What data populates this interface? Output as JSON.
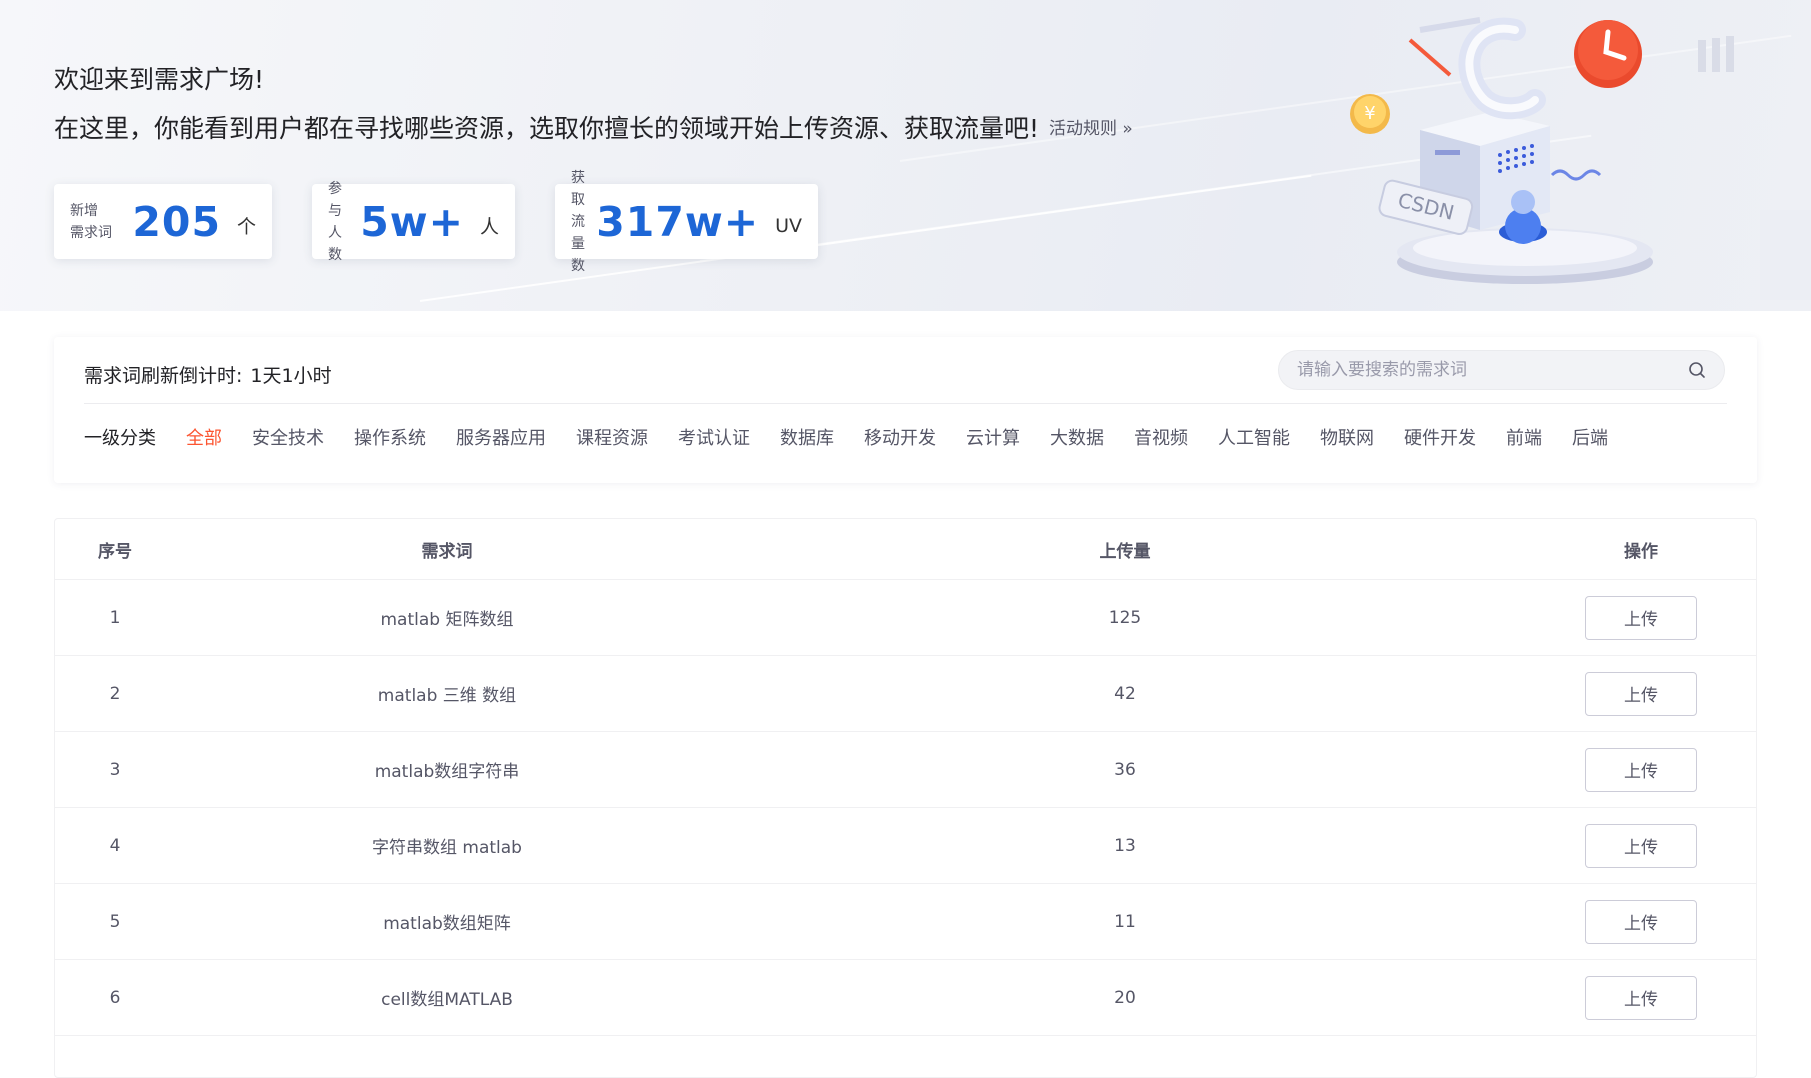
{
  "banner": {
    "welcome": "欢迎来到需求广场!",
    "subtitle": "在这里，你能看到用户都在寻找哪些资源，选取你擅长的领域开始上传资源、获取流量吧!",
    "rules_link": "活动规则 »",
    "stats": [
      {
        "label_line1": "新增",
        "label_line2": "需求词",
        "value": "205",
        "unit": "个"
      },
      {
        "label_line1": "参与",
        "label_line2": "人数",
        "value": "5w+",
        "unit": "人"
      },
      {
        "label_line1": "获取",
        "label_line2": "流量数",
        "value": "317w+",
        "unit": "UV"
      }
    ],
    "illustration_text": "CSDN"
  },
  "filter": {
    "countdown_label": "需求词刷新倒计时:",
    "countdown_value": "1天1小时",
    "search_placeholder": "请输入要搜索的需求词",
    "category_heading": "一级分类",
    "categories": [
      "全部",
      "安全技术",
      "操作系统",
      "服务器应用",
      "课程资源",
      "考试认证",
      "数据库",
      "移动开发",
      "云计算",
      "大数据",
      "音视频",
      "人工智能",
      "物联网",
      "硬件开发",
      "前端",
      "后端"
    ],
    "active_category": "全部"
  },
  "table": {
    "headers": {
      "index": "序号",
      "keyword": "需求词",
      "uploads": "上传量",
      "action": "操作"
    },
    "rows": [
      {
        "index": "1",
        "keyword": "matlab 矩阵数组",
        "uploads": "125",
        "action": "上传"
      },
      {
        "index": "2",
        "keyword": "matlab 三维 数组",
        "uploads": "42",
        "action": "上传"
      },
      {
        "index": "3",
        "keyword": "matlab数组字符串",
        "uploads": "36",
        "action": "上传"
      },
      {
        "index": "4",
        "keyword": "字符串数组 matlab",
        "uploads": "13",
        "action": "上传"
      },
      {
        "index": "5",
        "keyword": "matlab数组矩阵",
        "uploads": "11",
        "action": "上传"
      },
      {
        "index": "6",
        "keyword": "cell数组MATLAB",
        "uploads": "20",
        "action": "上传"
      }
    ]
  },
  "colors": {
    "accent_blue": "#1d66d6",
    "active_red": "#fc5531"
  }
}
